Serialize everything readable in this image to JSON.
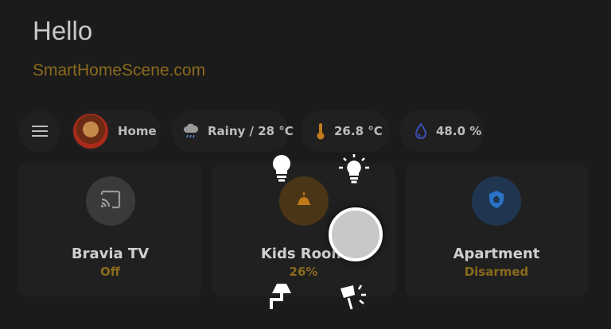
{
  "header": {
    "greeting": "Hello",
    "subtitle": "SmartHomeScene.com"
  },
  "chips": {
    "menu_icon": "menu-icon",
    "person": {
      "label": "Home",
      "icon": "avatar"
    },
    "weather": {
      "label": "Rainy / 28 °C",
      "icon": "rain-cloud-icon"
    },
    "temperature": {
      "label": "26.8 °C",
      "icon": "thermometer-icon",
      "color": "#c07a1a"
    },
    "humidity": {
      "label": "48.0 %",
      "icon": "water-drop-icon",
      "color": "#3b4fb8"
    }
  },
  "cards": [
    {
      "name": "Bravia TV",
      "state": "Off",
      "icon": "cast-icon",
      "icon_bg": "#3a3a3a",
      "icon_color": "#9a9a9a"
    },
    {
      "name": "Kids Room",
      "state": "26%",
      "icon": "ceiling-light-icon",
      "icon_bg": "#4a3516",
      "icon_color": "#c07a1a"
    },
    {
      "name": "Apartment",
      "state": "Disarmed",
      "icon": "shield-home-icon",
      "icon_bg": "#1f3550",
      "icon_color": "#2a74c8"
    }
  ],
  "radial_menu": {
    "icons": [
      "lightbulb-icon",
      "lightbulb-on-icon",
      "floor-lamp-icon",
      "lamp-off-icon"
    ]
  },
  "colors": {
    "background": "#1b1b1b",
    "card": "#202020",
    "accent": "#8a6a1c"
  }
}
